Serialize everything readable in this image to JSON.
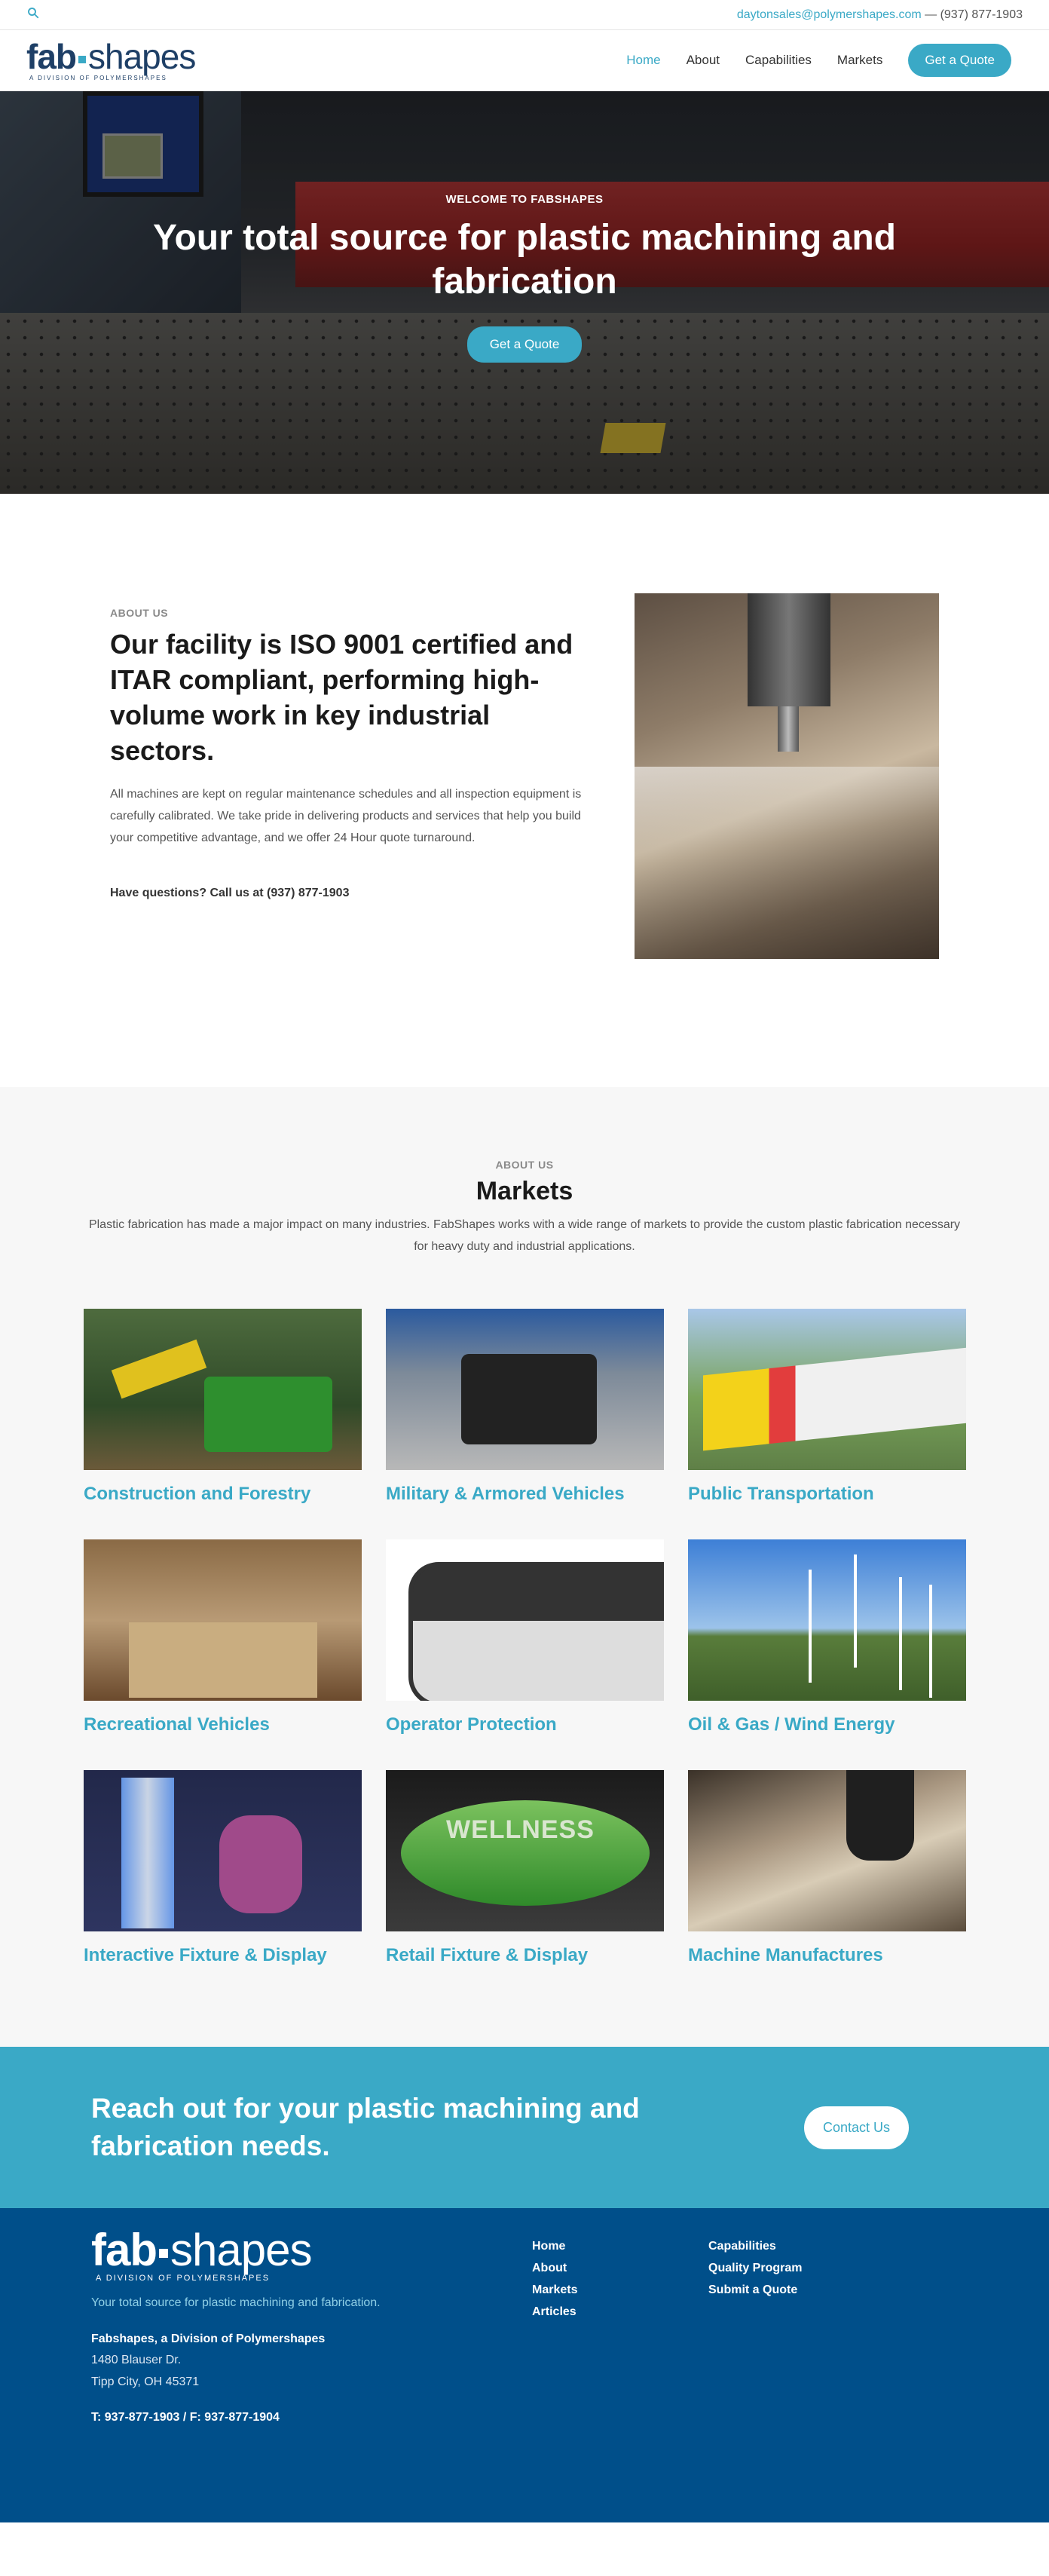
{
  "topbar": {
    "email": "daytonsales@polymershapes.com",
    "separator": " — ",
    "phone": "(937) 877-1903"
  },
  "logo": {
    "word_bold": "fab",
    "word_light": "shapes",
    "subtitle": "A DIVISION OF POLYMERSHAPES"
  },
  "nav": {
    "items": [
      {
        "label": "Home"
      },
      {
        "label": "About"
      },
      {
        "label": "Capabilities"
      },
      {
        "label": "Markets"
      }
    ],
    "quote_button": "Get a Quote"
  },
  "hero": {
    "kicker": "WELCOME TO FABSHAPES",
    "title": "Your total source for plastic machining and fabrication",
    "button": "Get a Quote"
  },
  "about": {
    "kicker": "ABOUT US",
    "heading": "Our facility is ISO 9001 certified and ITAR compliant, performing high-volume work in key industrial sectors.",
    "body": "All machines are kept on regular maintenance schedules and all inspection equipment is carefully calibrated. We take pride in delivering products and services that help you build your competitive advantage, and we offer 24 Hour quote turnaround.",
    "call": "Have questions? Call us at (937) 877-1903"
  },
  "markets": {
    "kicker": "ABOUT US",
    "heading": "Markets",
    "intro": "Plastic fabrication has made a major impact on many industries. FabShapes works with a wide range of markets to provide the custom plastic fabrication necessary for heavy duty and industrial applications.",
    "cards": [
      {
        "title": "Construction and Forestry"
      },
      {
        "title": "Military & Armored Vehicles"
      },
      {
        "title": "Public Transportation"
      },
      {
        "title": "Recreational Vehicles"
      },
      {
        "title": "Operator Protection"
      },
      {
        "title": "Oil & Gas / Wind Energy"
      },
      {
        "title": "Interactive Fixture & Display"
      },
      {
        "title": "Retail Fixture & Display",
        "image_text": "WELLNESS"
      },
      {
        "title": "Machine Manufactures"
      }
    ]
  },
  "cta": {
    "heading": "Reach out for your plastic machining and fabrication needs.",
    "button": "Contact Us"
  },
  "footer": {
    "tagline": "Your total source for plastic machining and fabrication.",
    "company": "Fabshapes, a Division of Polymershapes",
    "address_line1": "1480 Blauser Dr.",
    "address_line2": "Tipp City, OH 45371",
    "phones": "T: 937-877-1903 / F: 937-877-1904",
    "links_col1": [
      {
        "label": "Home"
      },
      {
        "label": "About"
      },
      {
        "label": "Markets"
      },
      {
        "label": "Articles"
      }
    ],
    "links_col2": [
      {
        "label": "Capabilities"
      },
      {
        "label": "Quality Program"
      },
      {
        "label": "Submit a Quote"
      }
    ]
  },
  "colors": {
    "accent": "#3aa9c6",
    "footer_bg": "#004f8a",
    "navy": "#1e3f66"
  }
}
